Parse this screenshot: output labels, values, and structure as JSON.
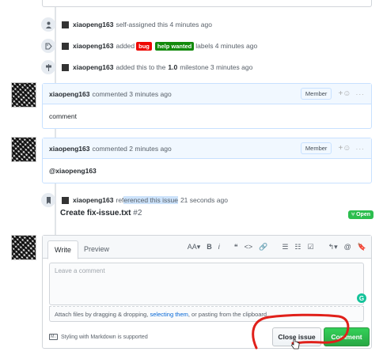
{
  "events": [
    {
      "user": "xiaopeng163",
      "text": "self-assigned this 4 minutes ago"
    },
    {
      "user": "xiaopeng163",
      "text_before": "added",
      "labels": [
        {
          "text": "bug",
          "bg": "#ee0701",
          "fg": "#ffffff"
        },
        {
          "text": "help wanted",
          "bg": "#128a0c",
          "fg": "#ffffff"
        }
      ],
      "text_after": "labels 4 minutes ago"
    },
    {
      "user": "xiaopeng163",
      "text_before": "added this to the",
      "milestone": "1.0",
      "text_after": "milestone 3 minutes ago"
    }
  ],
  "comments": [
    {
      "user": "xiaopeng163",
      "meta": "commented 3 minutes ago",
      "role": "Member",
      "body": "comment"
    },
    {
      "user": "xiaopeng163",
      "meta": "commented 2 minutes ago",
      "role": "Member",
      "body": "@xiaopeng163"
    }
  ],
  "reference": {
    "user": "xiaopeng163",
    "text_before": "ref",
    "text_highlight": "erenced this issue",
    "text_after": "21 seconds ago",
    "title": "Create fix-issue.txt",
    "number": "#2",
    "state": "Open"
  },
  "editor": {
    "tab_write": "Write",
    "tab_preview": "Preview",
    "toolbar": [
      "AA▾",
      "B",
      "i",
      "❝",
      "<>",
      "🔗",
      "☰",
      "☷",
      "☑",
      "↰▾",
      "@",
      "🔖"
    ],
    "placeholder": "Leave a comment",
    "attach_before": "Attach files by dragging & dropping,",
    "attach_link": "selecting them",
    "attach_after": ", or pasting from the clipboard.",
    "markdown_note": "Styling with Markdown is supported",
    "close_label": "Close issue",
    "comment_label": "Comment"
  },
  "colors": {
    "accent_green": "#28a745",
    "annotation_red": "#e0201a",
    "link_blue": "#0366d6"
  }
}
